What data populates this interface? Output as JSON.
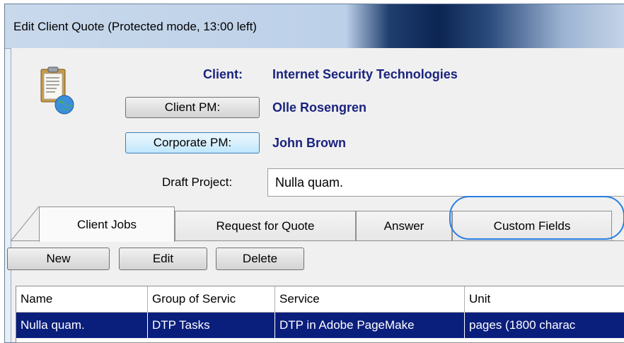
{
  "window": {
    "title": "Edit Client Quote (Protected mode, 13:00 left)"
  },
  "header": {
    "icon": "clipboard-globe-icon",
    "client_label": "Client:",
    "client_value": "Internet Security Technologies",
    "client_pm_button": "Client PM:",
    "client_pm_value": "Olle Rosengren",
    "corporate_pm_button": "Corporate PM:",
    "corporate_pm_value": "John Brown",
    "draft_project_label": "Draft Project:",
    "draft_project_value": "Nulla quam."
  },
  "tabs": [
    {
      "label": "Client Jobs",
      "active": true
    },
    {
      "label": "Request for Quote",
      "active": false
    },
    {
      "label": "Answer",
      "active": false
    },
    {
      "label": "Custom Fields",
      "active": false,
      "highlighted": true
    }
  ],
  "toolbar": {
    "new_label": "New",
    "edit_label": "Edit",
    "delete_label": "Delete"
  },
  "table": {
    "columns": [
      "Name",
      "Group of Servic",
      "Service",
      "Unit"
    ],
    "rows": [
      {
        "name": "Nulla quam.",
        "group": "DTP Tasks",
        "service": "DTP in Adobe PageMake",
        "unit": "pages (1800 charac",
        "selected": true
      }
    ]
  },
  "colors": {
    "accent_value_text": "#1a237e",
    "selection_bg": "#0a1e7c",
    "annotation_circle": "#2a7de1"
  }
}
